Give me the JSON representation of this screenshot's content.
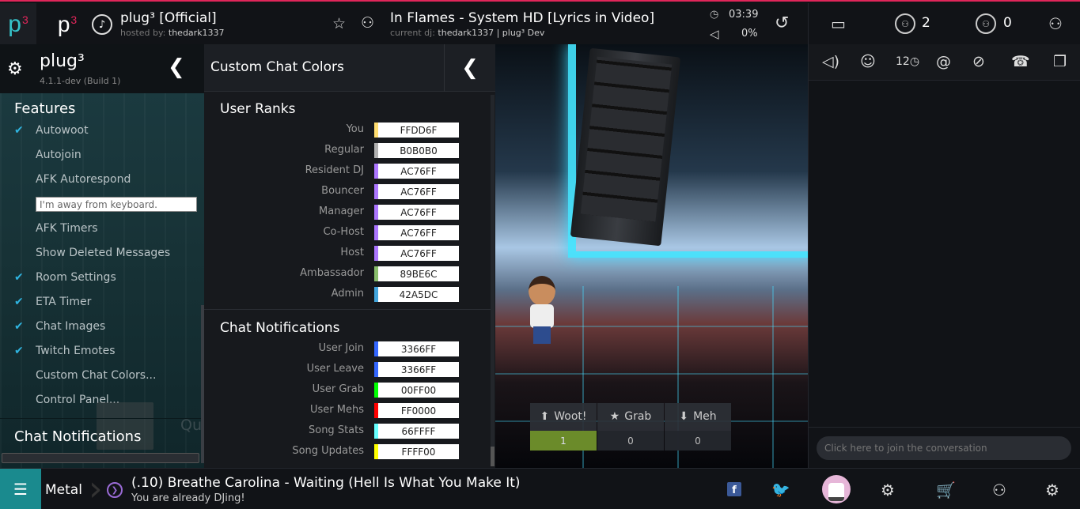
{
  "top": {
    "logo1": "p",
    "logo1_sup": "3",
    "logo2": "p",
    "logo2_sup": "3",
    "room_name": "plug³ [Official]",
    "hosted_by_label": "hosted by: ",
    "host": "thedark1337",
    "song_title": "In Flames - System HD [Lyrics in Video]",
    "current_dj_label": "current dj: ",
    "current_dj": "thedark1337 | plug³ Dev",
    "time": "03:39",
    "volume": "0%",
    "audience_count": "2",
    "waitlist_count": "0"
  },
  "plug3": {
    "title": "plug³",
    "version": "4.1.1-dev (Build 1)",
    "features_heading": "Features",
    "items": [
      {
        "label": "Autowoot",
        "checked": true
      },
      {
        "label": "Autojoin",
        "checked": false
      },
      {
        "label": "AFK Autorespond",
        "checked": false
      },
      {
        "label": "AFK Timers",
        "checked": false
      },
      {
        "label": "Show Deleted Messages",
        "checked": false
      },
      {
        "label": "Room Settings",
        "checked": true
      },
      {
        "label": "ETA Timer",
        "checked": true
      },
      {
        "label": "Chat Images",
        "checked": true
      },
      {
        "label": "Twitch Emotes",
        "checked": true
      },
      {
        "label": "Custom Chat Colors...",
        "checked": false
      },
      {
        "label": "Control Panel...",
        "checked": false
      }
    ],
    "afk_message": "I'm away from keyboard.",
    "notifications_heading": "Chat Notifications",
    "ghost_text": "Qu"
  },
  "colors": {
    "title": "Custom Chat Colors",
    "ranks_heading": "User Ranks",
    "ranks": [
      {
        "label": "You",
        "value": "FFDD6F",
        "color": "#FFDD6F"
      },
      {
        "label": "Regular",
        "value": "B0B0B0",
        "color": "#B0B0B0"
      },
      {
        "label": "Resident DJ",
        "value": "AC76FF",
        "color": "#AC76FF"
      },
      {
        "label": "Bouncer",
        "value": "AC76FF",
        "color": "#AC76FF"
      },
      {
        "label": "Manager",
        "value": "AC76FF",
        "color": "#AC76FF"
      },
      {
        "label": "Co-Host",
        "value": "AC76FF",
        "color": "#AC76FF"
      },
      {
        "label": "Host",
        "value": "AC76FF",
        "color": "#AC76FF"
      },
      {
        "label": "Ambassador",
        "value": "89BE6C",
        "color": "#89BE6C"
      },
      {
        "label": "Admin",
        "value": "42A5DC",
        "color": "#42A5DC"
      }
    ],
    "notifications_heading": "Chat Notifications",
    "notifications": [
      {
        "label": "User Join",
        "value": "3366FF",
        "color": "#3366FF"
      },
      {
        "label": "User Leave",
        "value": "3366FF",
        "color": "#3366FF"
      },
      {
        "label": "User Grab",
        "value": "00FF00",
        "color": "#00FF00"
      },
      {
        "label": "User Mehs",
        "value": "FF0000",
        "color": "#FF0000"
      },
      {
        "label": "Song Stats",
        "value": "66FFFF",
        "color": "#66FFFF"
      },
      {
        "label": "Song Updates",
        "value": "FFFF00",
        "color": "#FFFF00"
      }
    ]
  },
  "votes": {
    "woot_label": "Woot!",
    "woot_count": "1",
    "grab_label": "Grab",
    "grab_count": "0",
    "meh_label": "Meh",
    "meh_count": "0"
  },
  "chat": {
    "placeholder": "Click here to join the conversation",
    "timestamp_icon_text": "12"
  },
  "bottom": {
    "playlist": "Metal",
    "next_song": "(.10) Breathe Carolina - Waiting (Hell Is What You Make It)",
    "status": "You are already DJing!",
    "fb": "f"
  }
}
